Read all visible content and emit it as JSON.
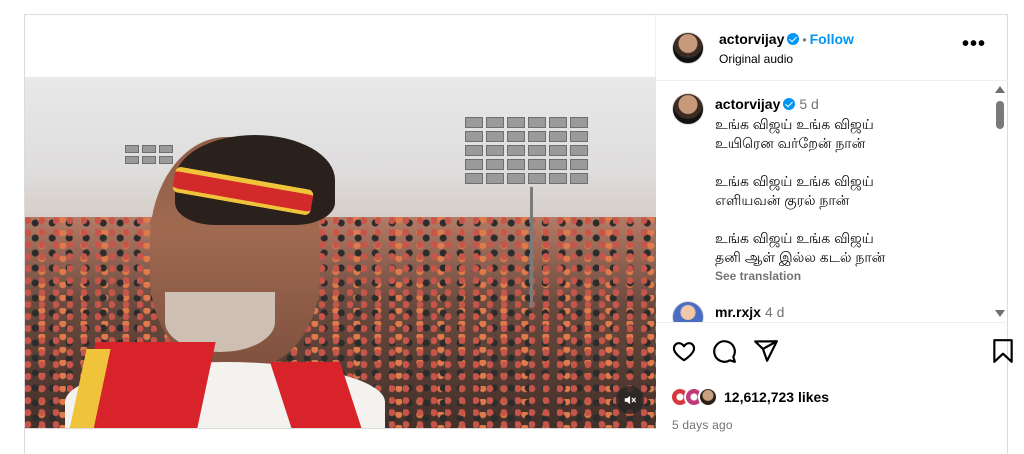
{
  "header": {
    "username": "actorvijay",
    "separator": "•",
    "follow_label": "Follow",
    "audio": "Original audio",
    "more_label": "•••"
  },
  "caption": {
    "username": "actorvijay",
    "time_ago": "5 d",
    "lines": [
      "உங்க விஜய் உங்க விஜய்",
      "உயிரென வர்றேன் நான்",
      "",
      "உங்க விஜய் உங்க விஜய்",
      "எளியவன் குரல் நான்",
      "",
      "உங்க விஜய் உங்க விஜய்",
      "தனி ஆள் இல்ல கடல் நான்"
    ],
    "see_translation": "See translation"
  },
  "comment": {
    "username": "mr.rxjx",
    "time_ago": "4 d"
  },
  "post": {
    "likes": "12,612,723 likes",
    "posted": "5 days ago"
  },
  "icons": {
    "like": "heart-icon",
    "comment": "comment-icon",
    "share": "send-icon",
    "save": "bookmark-icon",
    "mute": "speaker-muted-icon",
    "more": "more-options-icon"
  },
  "colors": {
    "link_blue": "#0095f6",
    "secondary_text": "#737373",
    "border": "#dbdbdb"
  }
}
